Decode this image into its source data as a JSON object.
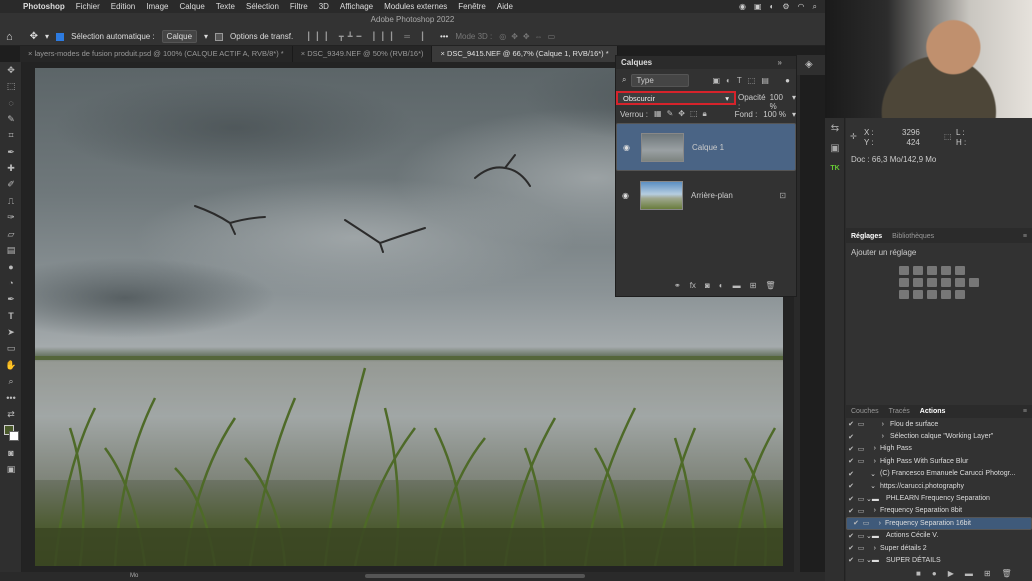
{
  "menubar": {
    "app": "Photoshop",
    "items": [
      "Fichier",
      "Edition",
      "Image",
      "Calque",
      "Texte",
      "Sélection",
      "Filtre",
      "3D",
      "Affichage",
      "Modules externes",
      "Fenêtre",
      "Aide"
    ]
  },
  "window_title": "Adobe Photoshop 2022",
  "options": {
    "auto_select_label": "Sélection automatique :",
    "auto_select_value": "Calque",
    "transform_label": "Options de transf.",
    "mode3d_label": "Mode 3D :"
  },
  "tabs": [
    {
      "label": "layers-modes de fusion produit.psd @ 100% (CALQUE ACTIF A, RVB/8*) *"
    },
    {
      "label": "DSC_9349.NEF @ 50% (RVB/16*)"
    },
    {
      "label": "DSC_9415.NEF @ 66,7% (Calque 1, RVB/16*) *"
    }
  ],
  "layers_panel": {
    "title": "Calques",
    "filter": "Type",
    "blend_mode": "Obscurcir",
    "opacity_label": "Opacité :",
    "opacity_value": "100 %",
    "lock_label": "Verrou :",
    "fill_label": "Fond :",
    "fill_value": "100 %",
    "layers": [
      {
        "name": "Calque 1",
        "selected": true
      },
      {
        "name": "Arrière-plan",
        "selected": false
      }
    ]
  },
  "info_panel": {
    "x_label": "X :",
    "x_value": "3296",
    "y_label": "Y :",
    "y_value": "424",
    "l_label": "L :",
    "h_label": "H :",
    "doc": "Doc : 66,3 Mo/142,9 Mo"
  },
  "reglages_panel": {
    "tab1": "Réglages",
    "tab2": "Bibliothèques",
    "hint": "Ajouter un réglage"
  },
  "actions_panel": {
    "tab1": "Couches",
    "tab2": "Tracés",
    "tab3": "Actions",
    "rows": [
      {
        "label": "Flou de surface",
        "indent": 3,
        "selected": false
      },
      {
        "label": "Sélection calque \"Working Layer\"",
        "indent": 3,
        "selected": false
      },
      {
        "label": "High Pass",
        "indent": 2,
        "selected": false
      },
      {
        "label": "High Pass With Surface Blur",
        "indent": 2,
        "selected": false
      },
      {
        "label": "(C) Francesco Emanuele Carucci Photogr...",
        "indent": 2,
        "selected": false
      },
      {
        "label": "https://carucci.photography",
        "indent": 2,
        "selected": false
      },
      {
        "label": "PHLEARN Frequency Separation",
        "indent": 1,
        "selected": false
      },
      {
        "label": "Frequency Separation 8bit",
        "indent": 2,
        "selected": false
      },
      {
        "label": "Frequency Separation 16bit",
        "indent": 2,
        "selected": true
      },
      {
        "label": "Actions Cécile V.",
        "indent": 1,
        "selected": false
      },
      {
        "label": "Super détails 2",
        "indent": 2,
        "selected": false
      },
      {
        "label": "SUPER DÉTAILS",
        "indent": 1,
        "selected": false
      }
    ]
  },
  "status": {
    "left": "Mo"
  },
  "colors": {
    "accent": "#2d7be0",
    "highlight_box": "#d6232b",
    "selected_layer": "#4a6485"
  }
}
